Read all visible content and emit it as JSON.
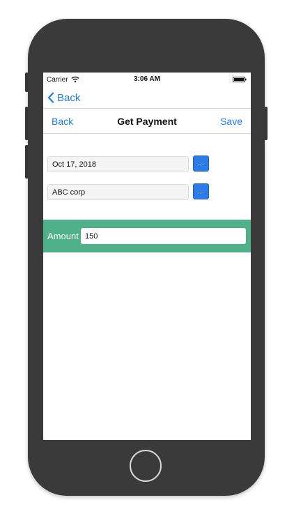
{
  "status_bar": {
    "carrier": "Carrier",
    "time": "3:06 AM"
  },
  "nav_bar": {
    "back_label": "Back"
  },
  "toolbar": {
    "back_label": "Back",
    "title": "Get Payment",
    "save_label": "Save"
  },
  "form": {
    "date_value": "Oct 17, 2018",
    "date_picker_label": "...",
    "customer_value": "ABC corp",
    "customer_picker_label": "...",
    "amount_label": "Amount",
    "amount_value": "150"
  },
  "colors": {
    "accent": "#1a7ef5",
    "picker_button": "#2b7ce9",
    "amount_band": "#4fb18a",
    "phone_body": "#3a3a3a"
  }
}
